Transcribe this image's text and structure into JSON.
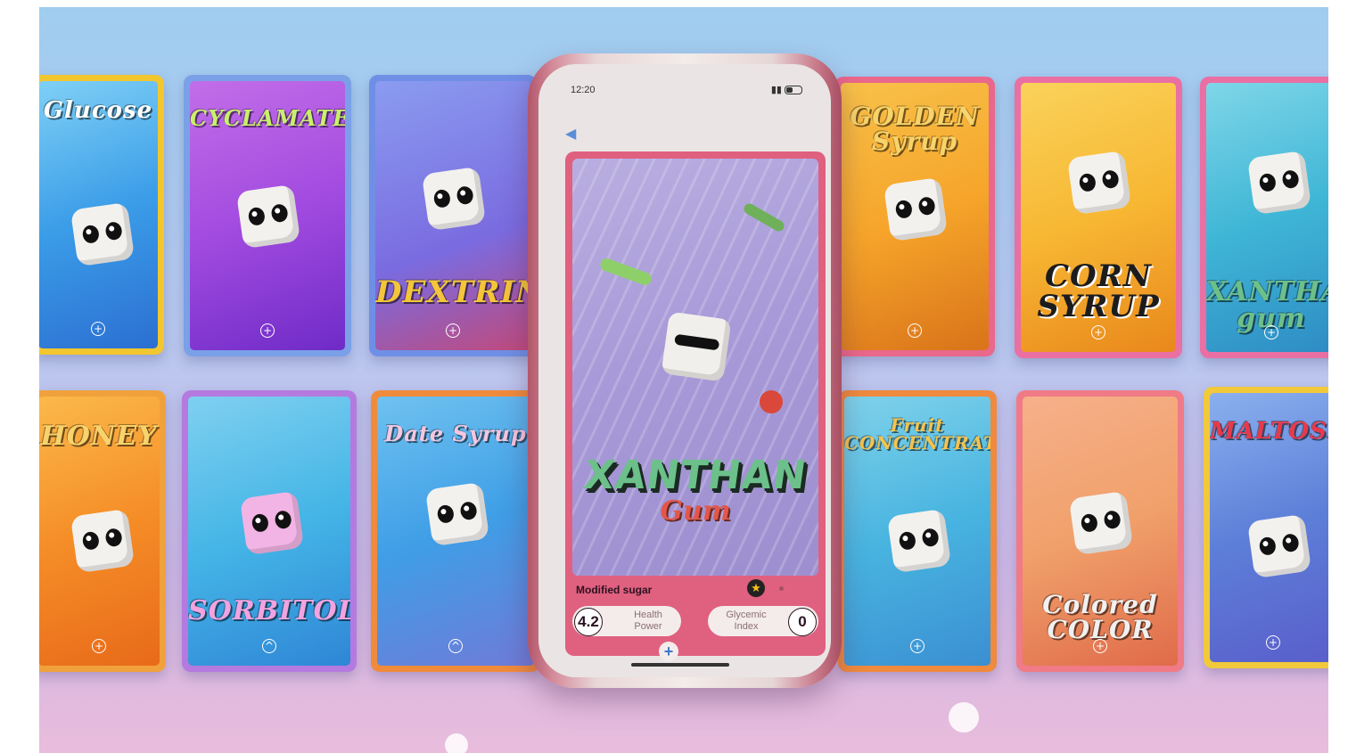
{
  "cards": [
    {
      "id": "glucose",
      "title": "Glucose",
      "colors": [
        "#f2c62f",
        "#3b9de8",
        "#2b6fd1"
      ]
    },
    {
      "id": "cyclamate",
      "title": "CYCLAMATE",
      "colors": [
        "#7aa0e8",
        "#a24be0",
        "#6f2bc7"
      ]
    },
    {
      "id": "dextrin",
      "title": "DEXTRIN",
      "colors": [
        "#6f8fe6",
        "#7a6be0",
        "#c04a7c"
      ]
    },
    {
      "id": "golden-syrup",
      "title": "GOLDEN Syrup",
      "colors": [
        "#e9688b",
        "#f6a52a",
        "#d9731a"
      ]
    },
    {
      "id": "corn-syrup",
      "title": "CORN SYRUP",
      "colors": [
        "#ea6fa3",
        "#f7b733",
        "#e9881c"
      ]
    },
    {
      "id": "xanthan-gum-right",
      "title": "XANTHAN gum",
      "colors": [
        "#ea6fa3",
        "#3fb6d6",
        "#2e8cc4"
      ]
    },
    {
      "id": "honey",
      "title": "HONEY",
      "colors": [
        "#f1a13c",
        "#f58d27",
        "#e86a1a"
      ]
    },
    {
      "id": "sorbitol",
      "title": "SORBITOL",
      "colors": [
        "#b47ae0",
        "#44b5e6",
        "#2f86d6"
      ]
    },
    {
      "id": "date-syrup",
      "title": "Date Syrup",
      "colors": [
        "#f08b3c",
        "#3f9ee6",
        "#6f7bd8"
      ]
    },
    {
      "id": "fruit-concentrate",
      "title": "Fruit CONCENTRATE",
      "colors": [
        "#ef8a3e",
        "#48b4e0",
        "#3b8fd2"
      ]
    },
    {
      "id": "caramel-color",
      "title": "Colored COLOR",
      "colors": [
        "#f07a86",
        "#f0a06a",
        "#e06b4a"
      ]
    },
    {
      "id": "maltose",
      "title": "MALTOSE",
      "colors": [
        "#f2c93a",
        "#5d7fd8",
        "#5a5ecb"
      ]
    }
  ],
  "phone": {
    "status_time": "12:20",
    "back_icon": "back-arrow-icon",
    "featured": {
      "title_main": "XANTHAN",
      "title_sub": "Gum",
      "category": "Modified sugar",
      "health_power_value": "4.2",
      "health_power_label_1": "Health",
      "health_power_label_2": "Power",
      "glycemic_label_1": "Glycemic",
      "glycemic_label_2": "Index",
      "glycemic_value": "0",
      "accent": "#e0607f"
    },
    "add_label": "+"
  }
}
